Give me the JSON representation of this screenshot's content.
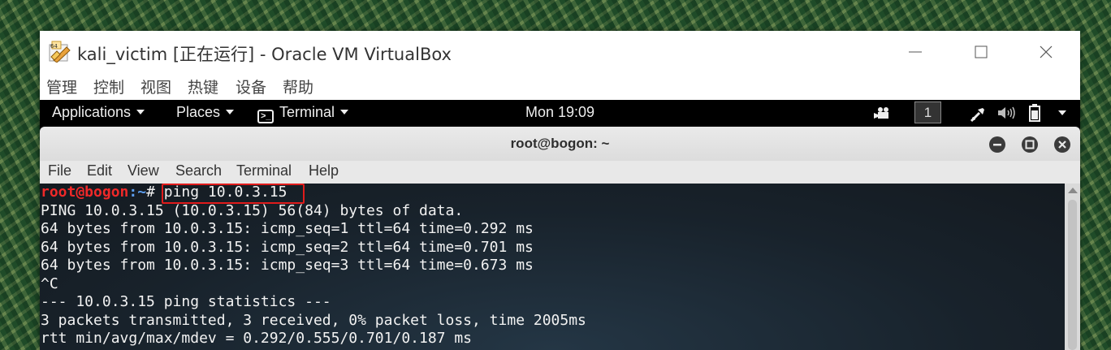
{
  "virtualbox": {
    "title": "kali_victim [正在运行] - Oracle VM VirtualBox",
    "menu": [
      "管理",
      "控制",
      "视图",
      "热键",
      "设备",
      "帮助"
    ]
  },
  "gnome_bar": {
    "applications": "Applications",
    "places": "Places",
    "terminal": "Terminal",
    "clock": "Mon 19:09",
    "workspace": "1"
  },
  "terminal": {
    "title": "root@bogon: ~",
    "menu": [
      "File",
      "Edit",
      "View",
      "Search",
      "Terminal",
      "Help"
    ],
    "prompt_user": "root@bogon",
    "prompt_path": ":~",
    "prompt_symbol": "# ",
    "command": "ping 10.0.3.15",
    "output": [
      "PING 10.0.3.15 (10.0.3.15) 56(84) bytes of data.",
      "64 bytes from 10.0.3.15: icmp_seq=1 ttl=64 time=0.292 ms",
      "64 bytes from 10.0.3.15: icmp_seq=2 ttl=64 time=0.701 ms",
      "64 bytes from 10.0.3.15: icmp_seq=3 ttl=64 time=0.673 ms",
      "^C",
      "--- 10.0.3.15 ping statistics ---",
      "3 packets transmitted, 3 received, 0% packet loss, time 2005ms",
      "rtt min/avg/max/mdev = 0.292/0.555/0.701/0.187 ms"
    ]
  },
  "colors": {
    "highlight_box": "#e01b1b",
    "prompt_user": "#ef2929",
    "prompt_path": "#5c9ded"
  }
}
